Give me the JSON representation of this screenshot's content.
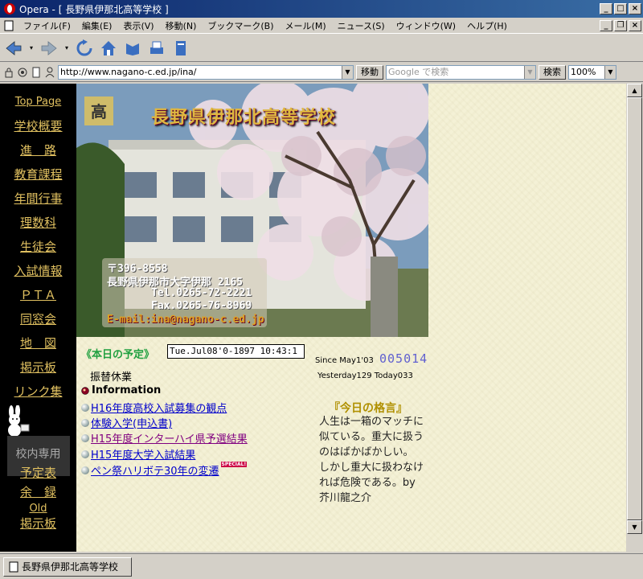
{
  "window": {
    "title": "Opera - [ 長野県伊那北高等学校 ]"
  },
  "menu": [
    "ファイル(F)",
    "編集(E)",
    "表示(V)",
    "移動(N)",
    "ブックマーク(B)",
    "メール(M)",
    "ニュース(S)",
    "ウィンドウ(W)",
    "ヘルプ(H)"
  ],
  "address": {
    "url": "http://www.nagano-c.ed.jp/ina/",
    "go_label": "移動",
    "search_placeholder": "Google で検索",
    "search_label": "検索",
    "zoom": "100%"
  },
  "sidebar": {
    "items": [
      "Top Page",
      "学校概要",
      "進　路",
      "教育課程",
      "年間行事",
      "理数科",
      "生徒会",
      "入試情報",
      "ＰＴＡ",
      "同窓会",
      "地　図",
      "掲示板",
      "リンク集"
    ],
    "inner_label": "校内専用",
    "inner_items": [
      "予定表",
      "余　録",
      "Old",
      "掲示板"
    ]
  },
  "banner": {
    "school_name": "長野県伊那北高等学校",
    "postal": "〒396-8558",
    "address": "長野県伊那市大字伊那 2165",
    "tel": "Tel.0265-72-2221",
    "fax": "Fax.0265-76-8969",
    "email": "E-mail:ina@nagano-c.ed.jp"
  },
  "schedule": {
    "label": "《本日の予定》",
    "clock": "Tue.Jul08'0-1897 10:43:1",
    "today": "振替休業"
  },
  "info_label": "Information",
  "news": [
    {
      "text": "H16年度高校入試募集の観点",
      "visited": false
    },
    {
      "text": "体験入学(申込書)",
      "visited": false
    },
    {
      "text": "H15年度インターハイ県予選結果",
      "visited": true
    },
    {
      "text": "H15年度大学入試結果",
      "visited": false
    },
    {
      "text": "ペン祭ハリボテ30年の変遷",
      "visited": false
    }
  ],
  "special_badge": "SPECIAL!",
  "counter": {
    "since": "Since May1'03",
    "total": "005014",
    "yesterday_today": "Yesterday129 Today033"
  },
  "kakugen": {
    "title": "『今日の格言』",
    "text": "人生は一箱のマッチに似ている。重大に扱うのはばかばかしい。しかし重大に扱わなければ危険である。by芥川龍之介"
  },
  "statusbar": {
    "tab_title": "長野県伊那北高等学校"
  }
}
